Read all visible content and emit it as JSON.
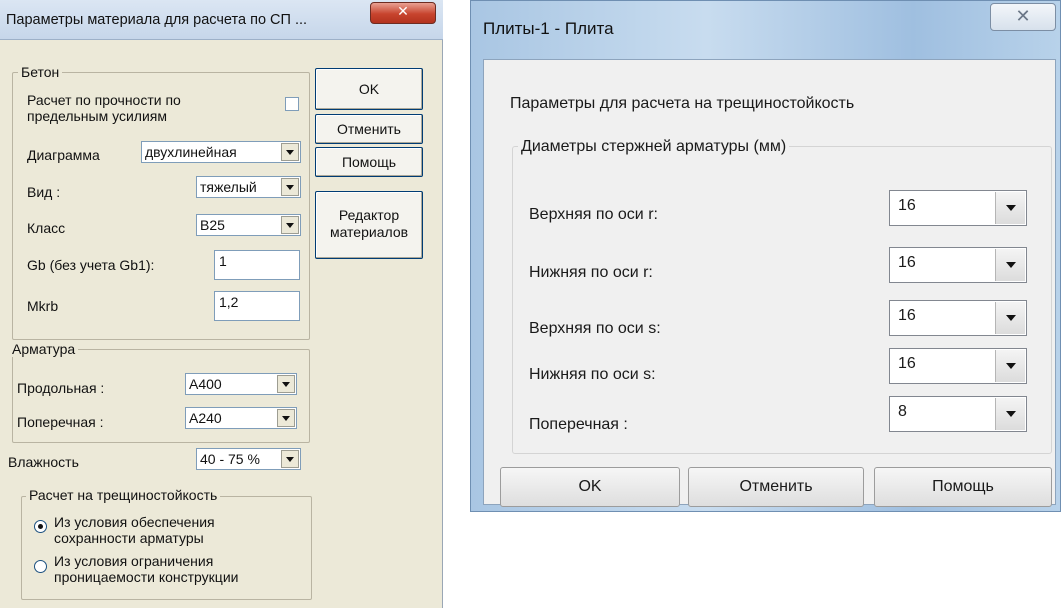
{
  "dialog1": {
    "title": "Параметры материала для расчета по СП ...",
    "concrete": {
      "group_label": "Бетон",
      "strength_check_label_line1": "Расчет по прочности по",
      "strength_check_label_line2": "предельным усилиям",
      "diagram_label": "Диаграмма",
      "diagram_value": "двухлинейная",
      "type_label": "Вид :",
      "type_value": "тяжелый",
      "class_label": "Класс",
      "class_value": "B25",
      "gb_label": "Gb (без учета Gb1):",
      "gb_value": "1",
      "mkrb_label": "Mkrb",
      "mkrb_value": "1,2"
    },
    "reinforcement": {
      "group_label": "Арматура",
      "longitudinal_label": "Продольная :",
      "longitudinal_value": "A400",
      "transverse_label": "Поперечная :",
      "transverse_value": "A240"
    },
    "humidity_label": "Влажность",
    "humidity_value": "40 - 75 %",
    "crack": {
      "group_label": "Расчет на трещиностойкость",
      "option1_line1": "Из условия обеспечения",
      "option1_line2": "сохранности арматуры",
      "option2_line1": "Из условия ограничения",
      "option2_line2": "проницаемости конструкции"
    },
    "buttons": {
      "ok": "OK",
      "cancel": "Отменить",
      "help": "Помощь",
      "editor_line1": "Редактор",
      "editor_line2": "материалов"
    }
  },
  "dialog2": {
    "title": "Плиты-1 - Плита",
    "heading": "Параметры для расчета на трещиностойкость",
    "group_label": "Диаметры стержней арматуры (мм)",
    "rows": [
      {
        "label": "Верхняя по оси r:",
        "value": "16"
      },
      {
        "label": "Нижняя  по оси r:",
        "value": "16"
      },
      {
        "label": "Верхняя по оси s:",
        "value": "16"
      },
      {
        "label": "Нижняя  по оси s:",
        "value": "16"
      },
      {
        "label": "Поперечная :",
        "value": "8"
      }
    ],
    "buttons": {
      "ok": "OK",
      "cancel": "Отменить",
      "help": "Помощь"
    }
  }
}
